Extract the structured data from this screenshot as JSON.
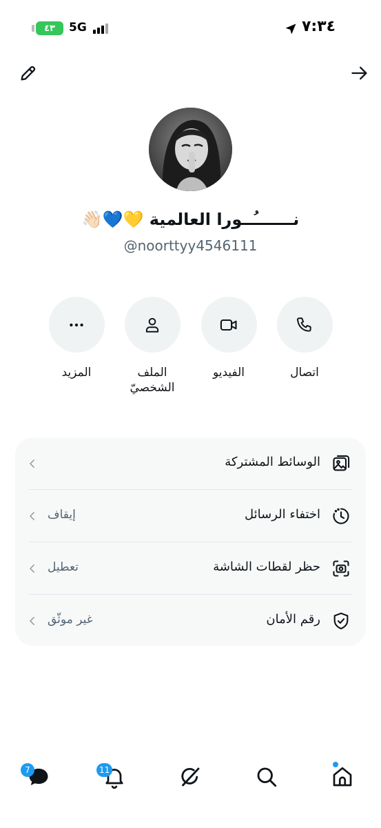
{
  "status_bar": {
    "time": "٧:٣٤",
    "battery": "٤٣",
    "network": "5G"
  },
  "profile": {
    "display_name": "نـــــــُــورا العالمية 💛💙👋🏻",
    "handle": "@noorttyy4546111"
  },
  "actions": [
    {
      "label": "اتصال",
      "icon": "phone-icon"
    },
    {
      "label": "الفيديو",
      "icon": "video-icon"
    },
    {
      "label": "الملف الشخصيّ",
      "icon": "person-icon"
    },
    {
      "label": "المزيد",
      "icon": "more-icon"
    }
  ],
  "settings": [
    {
      "label": "الوسائط المشتركة",
      "value": "",
      "icon": "media-icon"
    },
    {
      "label": "اختفاء الرسائل",
      "value": "إيقاف",
      "icon": "timer-icon"
    },
    {
      "label": "حظر لقطات الشاشة",
      "value": "تعطيل",
      "icon": "screenshot-icon"
    },
    {
      "label": "رقم الأمان",
      "value": "غير موثّق",
      "icon": "shield-icon"
    }
  ],
  "nav": {
    "messages_badge": "7",
    "notifications_badge": "11"
  },
  "colors": {
    "accent": "#1d9bf0",
    "text": "#0f1419",
    "secondary": "#536471",
    "card": "#f7f9f9",
    "circle": "#eff3f4",
    "battery": "#34c759"
  }
}
